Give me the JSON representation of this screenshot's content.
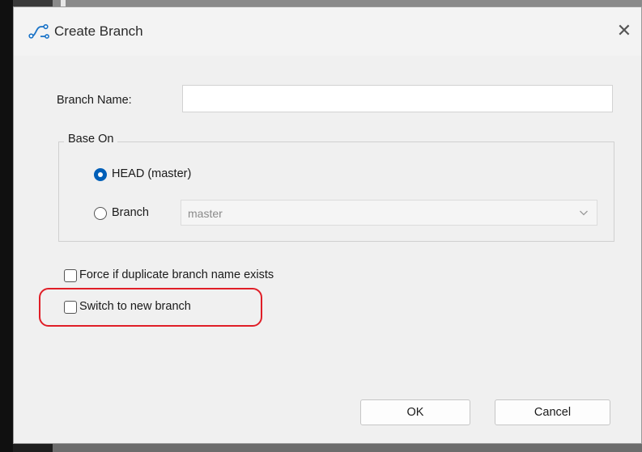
{
  "dialog": {
    "title": "Create Branch",
    "close_symbol": "✕",
    "icons": {
      "title_icon": "branch-icon",
      "close_icon": "close-icon"
    }
  },
  "form": {
    "branch_name_label": "Branch Name:",
    "branch_name_value": "",
    "group_label": "Base On",
    "radio_head_label": "HEAD (master)",
    "radio_head_checked": true,
    "radio_branch_label": "Branch",
    "radio_branch_checked": false,
    "branch_select_value": "master",
    "force_label": "Force if duplicate branch name exists",
    "force_checked": false,
    "switch_label": "Switch to new branch",
    "switch_checked": false
  },
  "buttons": {
    "ok": "OK",
    "cancel": "Cancel"
  },
  "colors": {
    "accent": "#005fb8",
    "highlight": "#e01e27"
  }
}
